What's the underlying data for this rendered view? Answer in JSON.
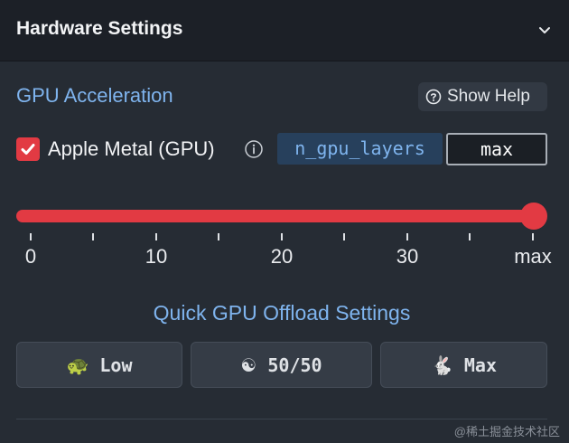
{
  "header": {
    "title": "Hardware Settings",
    "toggle_icon": "chevron-down-icon"
  },
  "gpu": {
    "section_title": "GPU Acceleration",
    "help_label": "Show Help",
    "help_icon": "question-circle-icon",
    "metal_checked": true,
    "metal_label": "Apple Metal (GPU)",
    "info_icon": "info-circle-icon",
    "param_name": "n_gpu_layers",
    "param_value": "max",
    "slider_value_fraction": 1.0,
    "slider_ticks": [
      "0",
      "10",
      "20",
      "30",
      "max"
    ],
    "accent_color": "#e23a43"
  },
  "quick": {
    "title": "Quick GPU Offload Settings",
    "presets": [
      {
        "icon": "🐢",
        "label": "Low"
      },
      {
        "icon": "☯",
        "label": "50/50"
      },
      {
        "icon": "🐇",
        "label": "Max"
      }
    ]
  },
  "watermark": "@稀土掘金技术社区"
}
